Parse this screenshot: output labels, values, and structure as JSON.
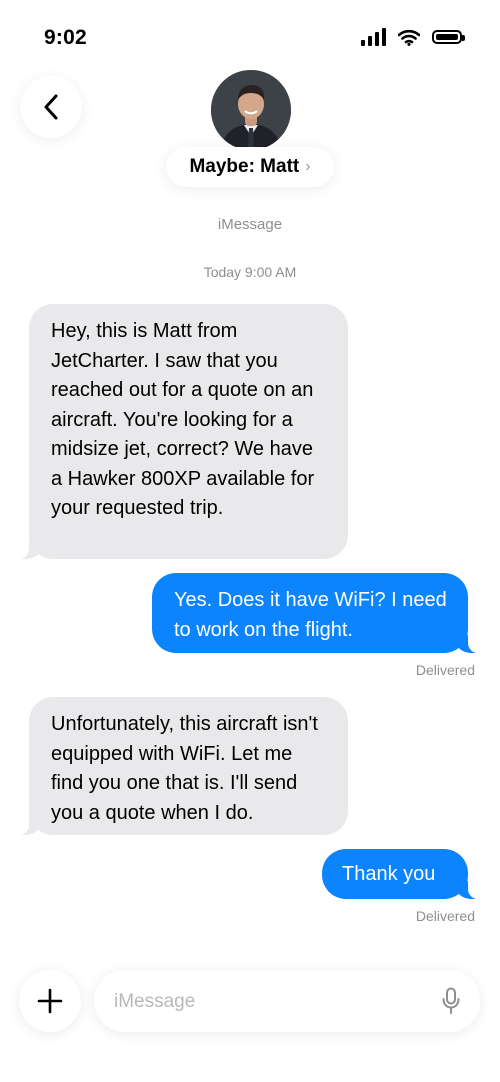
{
  "status_bar": {
    "time": "9:02"
  },
  "header": {
    "contact_name": "Maybe: Matt",
    "chevron": "›",
    "service": "iMessage"
  },
  "thread": {
    "date": "Today 9:00 AM",
    "messages": [
      {
        "direction": "incoming",
        "text": "Hey, this is Matt from JetCharter. I saw that you reached out for a quote on an aircraft. You're looking for a midsize jet, correct? We have a Hawker 800XP available for your requested trip."
      },
      {
        "direction": "outgoing",
        "text": "Yes. Does it have WiFi? I need to work on the flight.",
        "status": "Delivered"
      },
      {
        "direction": "incoming",
        "text": "Unfortunately, this aircraft isn't equipped with WiFi. Let me find you one that is. I'll send you a quote when I do."
      },
      {
        "direction": "outgoing",
        "text": "Thank you",
        "status": "Delivered"
      }
    ]
  },
  "composer": {
    "placeholder": "iMessage"
  },
  "icons": {
    "back": "chevron-left-icon",
    "signal": "cellular-signal-icon",
    "wifi": "wifi-icon",
    "battery": "battery-icon",
    "add": "plus-icon",
    "mic": "microphone-icon"
  },
  "colors": {
    "outgoing_bubble": "#0b84fe",
    "incoming_bubble": "#e9e9eb",
    "meta_text": "#8e8e93"
  }
}
